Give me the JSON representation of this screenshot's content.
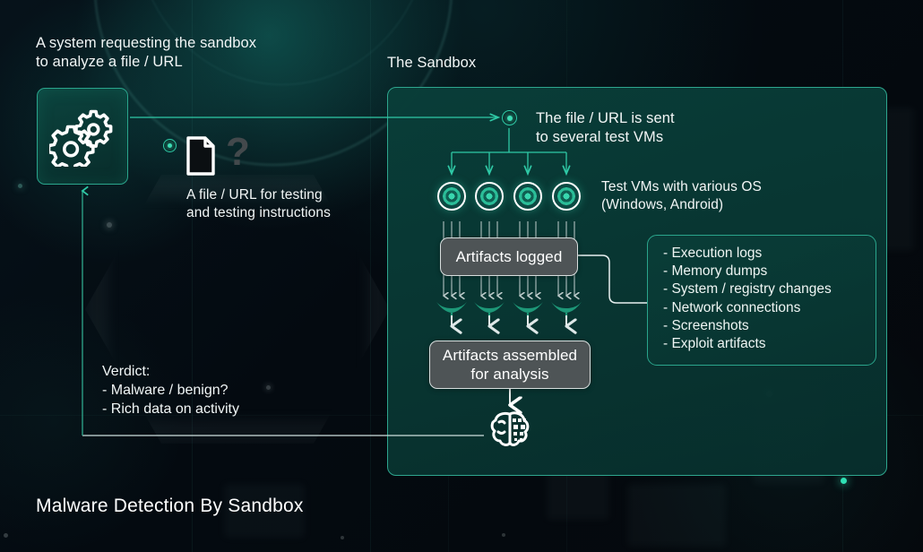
{
  "meta": {
    "footer_title": "Malware Detection By Sandbox",
    "accent": "#2aa58c",
    "accent_bright": "#3ddcb4",
    "panel_fill": "#093e39",
    "grey_box": "#4e5456",
    "text": "#f2f6f6"
  },
  "left": {
    "heading": "A system requesting the sandbox\nto analyze a file / URL",
    "system_icon": "gears-icon",
    "file_caption": "A file / URL for testing\nand testing instructions",
    "file_icon": "document-icon",
    "question_icon": "?",
    "verdict": {
      "title": "Verdict:",
      "items": [
        "- Malware / benign?",
        "- Rich data on activity"
      ]
    }
  },
  "sandbox": {
    "heading": "The Sandbox",
    "entry_caption": "The file / URL is sent\nto several test VMs",
    "vm_caption": "Test VMs with various OS\n(Windows, Android)",
    "vm_count": 4,
    "funnel_groups": 4,
    "box_logged": "Artifacts logged",
    "box_assembled": "Artifacts assembled\nfor analysis",
    "analysis_icon": "brain-circuit-icon",
    "artifacts": {
      "items": [
        "- Execution logs",
        "- Memory dumps",
        "- System / registry changes",
        "- Network connections",
        "- Screenshots",
        "- Exploit artifacts"
      ]
    }
  }
}
